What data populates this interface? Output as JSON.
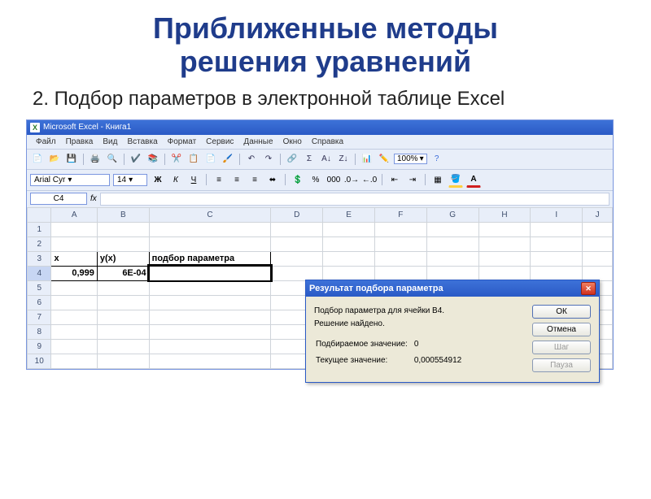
{
  "slide": {
    "title_line1": "Приближенные методы",
    "title_line2": "решения уравнений",
    "subtitle": "2. Подбор параметров в электронной таблице Excel"
  },
  "excel": {
    "app_title": "Microsoft Excel - Книга1",
    "menu": [
      "Файл",
      "Правка",
      "Вид",
      "Вставка",
      "Формат",
      "Сервис",
      "Данные",
      "Окно",
      "Справка"
    ],
    "zoom": "100%",
    "font_name": "Arial Cyr",
    "font_size": "14",
    "name_box": "C4",
    "fx_label": "fx",
    "columns": [
      "A",
      "B",
      "C",
      "D",
      "E",
      "F",
      "G",
      "H",
      "I",
      "J"
    ],
    "rows": [
      "1",
      "2",
      "3",
      "4",
      "5",
      "6",
      "7",
      "8",
      "9",
      "10"
    ],
    "cells": {
      "A3": "x",
      "B3": "y(x)",
      "C3": "подбор параметра",
      "A4": "0,999",
      "B4": "6E-04"
    }
  },
  "dialog": {
    "title": "Результат подбора параметра",
    "line1": "Подбор параметра для ячейки B4.",
    "line2": "Решение найдено.",
    "label_target": "Подбираемое значение:",
    "val_target": "0",
    "label_current": "Текущее значение:",
    "val_current": "0,000554912",
    "btn_ok": "ОК",
    "btn_cancel": "Отмена",
    "btn_step": "Шаг",
    "btn_pause": "Пауза"
  }
}
